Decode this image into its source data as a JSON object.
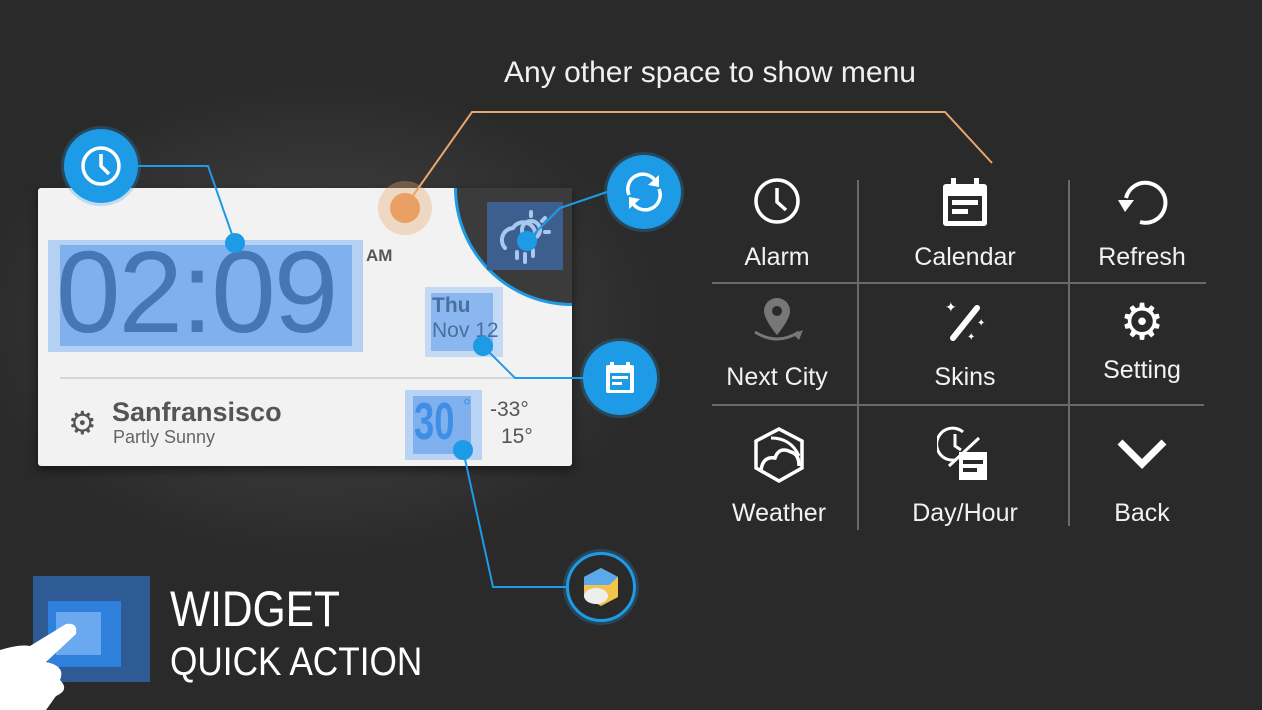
{
  "hint": "Any other space to show menu",
  "widget": {
    "time": "02:09",
    "ampm": "AM",
    "day": "Thu",
    "date": "Nov 12",
    "city": "Sanfransisco",
    "condition": "Partly Sunny",
    "temp": "30",
    "temp_unit": "°",
    "high": "-33°",
    "low": "15°"
  },
  "menu": {
    "items": [
      {
        "label": "Alarm",
        "icon": "clock-icon"
      },
      {
        "label": "Calendar",
        "icon": "calendar-icon"
      },
      {
        "label": "Refresh",
        "icon": "refresh-icon"
      },
      {
        "label": "Next City",
        "icon": "location-switch-icon"
      },
      {
        "label": "Skins",
        "icon": "magic-wand-icon"
      },
      {
        "label": "Setting",
        "icon": "gear-icon"
      },
      {
        "label": "Weather",
        "icon": "weather-app-icon"
      },
      {
        "label": "Day/Hour",
        "icon": "day-hour-icon"
      },
      {
        "label": "Back",
        "icon": "chevron-down-icon"
      }
    ]
  },
  "banner": {
    "title": "WIDGET",
    "subtitle": "QUICK ACTION"
  },
  "colors": {
    "accent": "#1e9be6",
    "hint_line": "#e8a66e",
    "highlight": "#80b1ee",
    "background": "#2a2a2a"
  }
}
